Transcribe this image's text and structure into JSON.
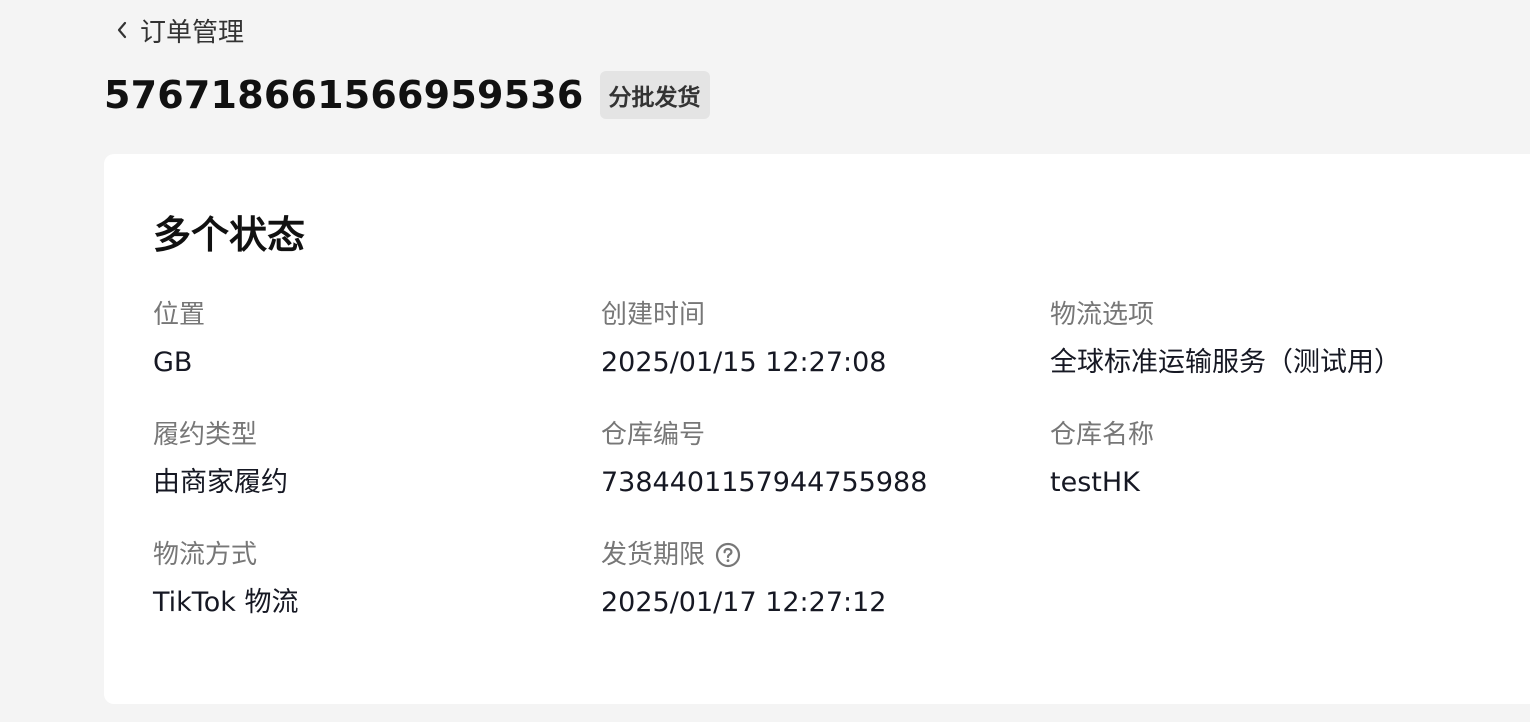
{
  "nav": {
    "back_label": "订单管理"
  },
  "order": {
    "id": "576718661566959536",
    "badge": "分批发货"
  },
  "card": {
    "title": "多个状态",
    "fields": [
      {
        "label": "位置",
        "value": "GB"
      },
      {
        "label": "创建时间",
        "value": "2025/01/15 12:27:08"
      },
      {
        "label": "物流选项",
        "value": "全球标准运输服务（测试用）"
      },
      {
        "label": "履约类型",
        "value": "由商家履约"
      },
      {
        "label": "仓库编号",
        "value": "7384401157944755988"
      },
      {
        "label": "仓库名称",
        "value": "testHK"
      },
      {
        "label": "物流方式",
        "value": "TikTok 物流"
      },
      {
        "label": "发货期限",
        "value": "2025/01/17 12:27:12"
      }
    ]
  },
  "icons": {
    "back": "chevron-left-icon",
    "help": "question-circle-icon"
  },
  "colors": {
    "page_bg": "#f4f4f4",
    "card_bg": "#ffffff",
    "badge_bg": "#e4e4e4",
    "label": "#777777",
    "text": "#161823"
  }
}
